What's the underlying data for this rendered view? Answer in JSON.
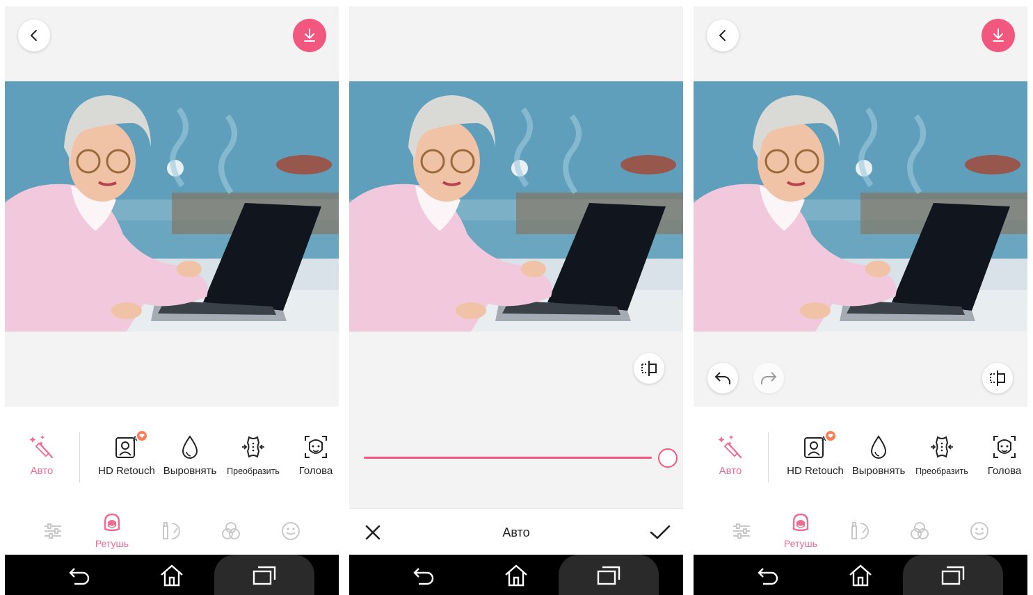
{
  "colors": {
    "accent": "#f2587f",
    "accent_text": "#ef6b91",
    "badge": "#ff7b55"
  },
  "icons": {
    "back": "chevron-left-icon",
    "download": "download-icon",
    "compare": "compare-icon",
    "undo": "undo-icon",
    "redo": "redo-icon",
    "auto": "magic-wand-icon",
    "hd_retouch": "ai-portrait-icon",
    "smooth": "drop-icon",
    "reshape": "body-reshape-icon",
    "head": "face-frame-icon",
    "adjust": "sliders-icon",
    "retouch": "face-icon",
    "makeup": "makeup-icon",
    "filters": "filters-icon",
    "stickers": "smiley-icon",
    "nav_back": "nav-back-icon",
    "nav_home": "nav-home-icon",
    "nav_recent": "nav-recent-icon",
    "cancel": "close-icon",
    "confirm": "check-icon"
  },
  "screen1": {
    "tools": [
      {
        "label": "Авто",
        "active": true
      },
      {
        "label": "HD Retouch",
        "active": false
      },
      {
        "label": "Выровнять",
        "active": false
      },
      {
        "label": "Преобразить",
        "active": false
      },
      {
        "label": "Голова",
        "active": false
      }
    ],
    "active_tab_label": "Ретушь"
  },
  "screen2": {
    "bottom_title": "Авто",
    "slider_value": 1.0
  },
  "screen3": {
    "tools": [
      {
        "label": "Авто",
        "active": true
      },
      {
        "label": "HD Retouch",
        "active": false
      },
      {
        "label": "Выровнять",
        "active": false
      },
      {
        "label": "Преобразить",
        "active": false
      },
      {
        "label": "Голова",
        "active": false
      }
    ],
    "active_tab_label": "Ретушь"
  }
}
